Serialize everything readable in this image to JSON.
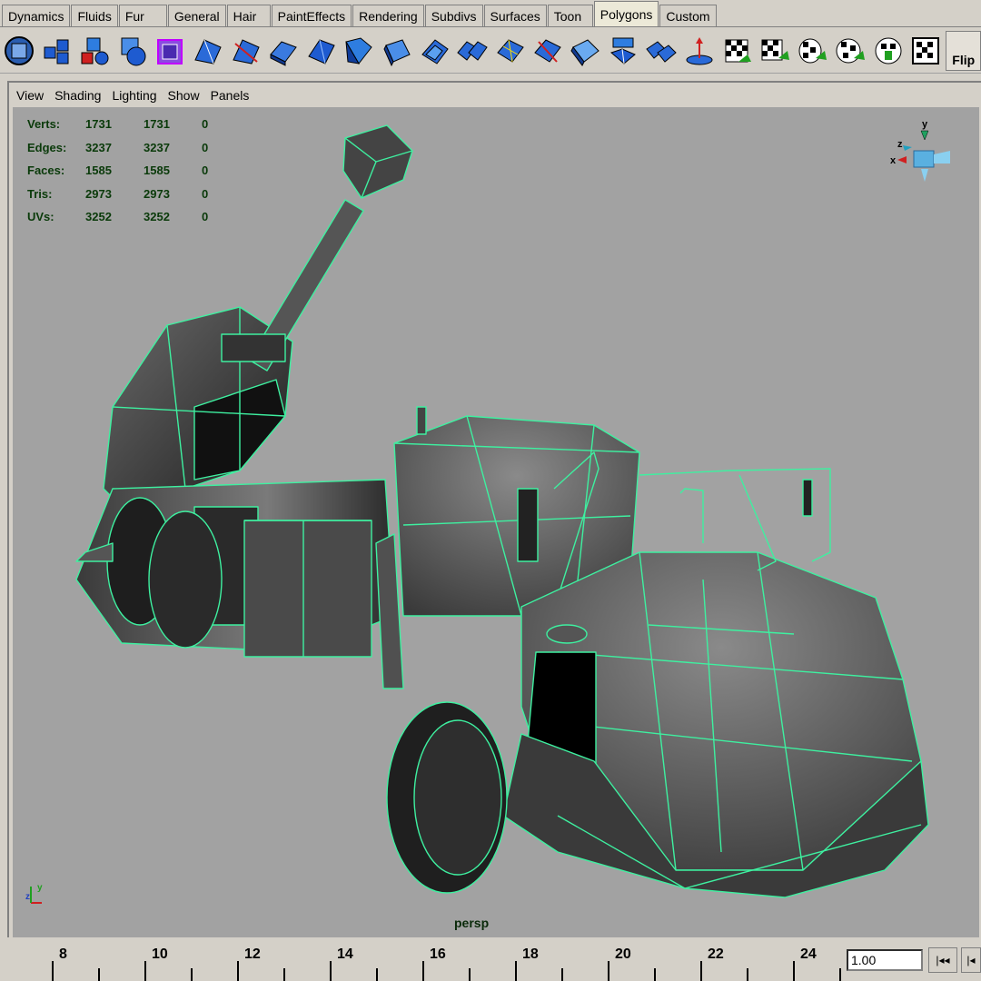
{
  "shelf": {
    "tabs": [
      "Dynamics",
      "Fluids",
      "Fur",
      "General",
      "Hair",
      "PaintEffects",
      "Rendering",
      "Subdivs",
      "Surfaces",
      "Toon",
      "Polygons",
      "Custom"
    ],
    "active_tab": "Polygons",
    "flip_label": "Flip"
  },
  "panel": {
    "menu": [
      "View",
      "Shading",
      "Lighting",
      "Show",
      "Panels"
    ],
    "camera": "persp"
  },
  "hud": {
    "rows": [
      {
        "label": "Verts:",
        "v1": "1731",
        "v2": "1731",
        "v3": "0"
      },
      {
        "label": "Edges:",
        "v1": "3237",
        "v2": "3237",
        "v3": "0"
      },
      {
        "label": "Faces:",
        "v1": "1585",
        "v2": "1585",
        "v3": "0"
      },
      {
        "label": "Tris:",
        "v1": "2973",
        "v2": "2973",
        "v3": "0"
      },
      {
        "label": "UVs:",
        "v1": "3252",
        "v2": "3252",
        "v3": "0"
      }
    ]
  },
  "axis_gizmo": {
    "y": "y",
    "x": "x",
    "z": "z"
  },
  "timeline": {
    "labels": [
      "8",
      "10",
      "12",
      "14",
      "16",
      "18",
      "20",
      "22",
      "24"
    ],
    "current_frame": "1.00"
  },
  "colors": {
    "wire": "#3ef0a0",
    "viewport_bg": "#a2a2a2",
    "ui_bg": "#d4d0c8"
  }
}
